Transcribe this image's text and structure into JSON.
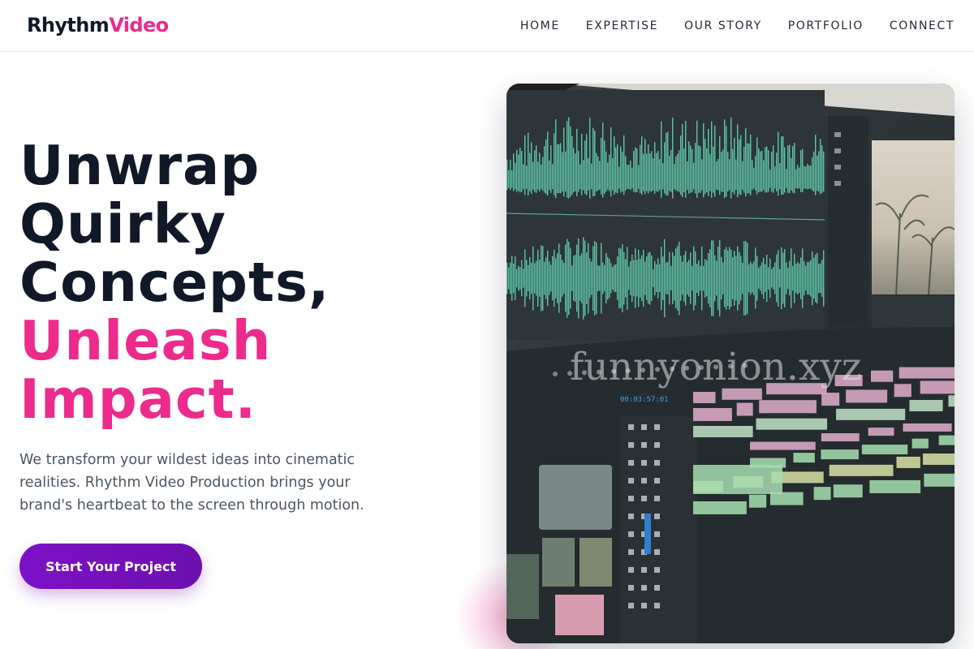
{
  "brand": {
    "part1": "Rhythm",
    "part2": "Video",
    "accent": "#ec2b8c"
  },
  "nav": {
    "items": [
      "HOME",
      "EXPERTISE",
      "OUR STORY",
      "PORTFOLIO",
      "CONNECT"
    ]
  },
  "hero": {
    "headline_lines": [
      "Unwrap",
      "Quirky",
      "Concepts,",
      "Unleash",
      "Impact."
    ],
    "subtext": "We transform your wildest ideas into cinematic realities. Rhythm Video Production brings your brand's heartbeat to the screen through motion.",
    "cta_label": "Start Your Project",
    "cta_color": "#7c12c7"
  },
  "media": {
    "subject": "video editing timeline with audio waveform on monitor",
    "watermark": "funnyonion.xyz",
    "timecode": "00:03:57:01"
  }
}
